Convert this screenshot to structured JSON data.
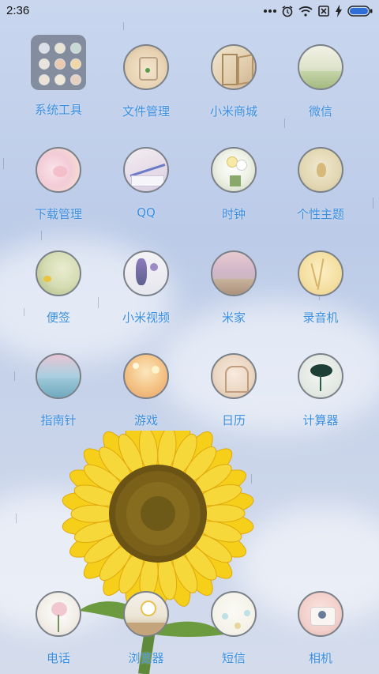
{
  "status_bar": {
    "time": "2:36",
    "icons": [
      "more-dots-icon",
      "alarm-icon",
      "wifi-icon",
      "no-sim-icon",
      "charging-icon",
      "battery-icon"
    ],
    "battery_color": "#2f6fd6"
  },
  "home": {
    "rows": [
      [
        {
          "label": "系统工具",
          "icon": "folder-icon"
        },
        {
          "label": "文件管理",
          "icon": "file-manager-icon"
        },
        {
          "label": "小米商城",
          "icon": "mi-store-icon"
        },
        {
          "label": "微信",
          "icon": "wechat-icon"
        }
      ],
      [
        {
          "label": "下载管理",
          "icon": "download-manager-icon"
        },
        {
          "label": "QQ",
          "icon": "qq-icon"
        },
        {
          "label": "时钟",
          "icon": "clock-icon"
        },
        {
          "label": "个性主题",
          "icon": "themes-icon"
        }
      ],
      [
        {
          "label": "便签",
          "icon": "notes-icon"
        },
        {
          "label": "小米视频",
          "icon": "mi-video-icon"
        },
        {
          "label": "米家",
          "icon": "mi-home-icon"
        },
        {
          "label": "录音机",
          "icon": "recorder-icon"
        }
      ],
      [
        {
          "label": "指南针",
          "icon": "compass-icon"
        },
        {
          "label": "游戏",
          "icon": "games-icon"
        },
        {
          "label": "日历",
          "icon": "calendar-icon"
        },
        {
          "label": "计算器",
          "icon": "calculator-icon"
        }
      ]
    ],
    "dock": [
      {
        "label": "电话",
        "icon": "phone-icon"
      },
      {
        "label": "浏览器",
        "icon": "browser-icon"
      },
      {
        "label": "短信",
        "icon": "messages-icon"
      },
      {
        "label": "相机",
        "icon": "camera-icon"
      }
    ],
    "label_color": "#3a8ee0"
  }
}
